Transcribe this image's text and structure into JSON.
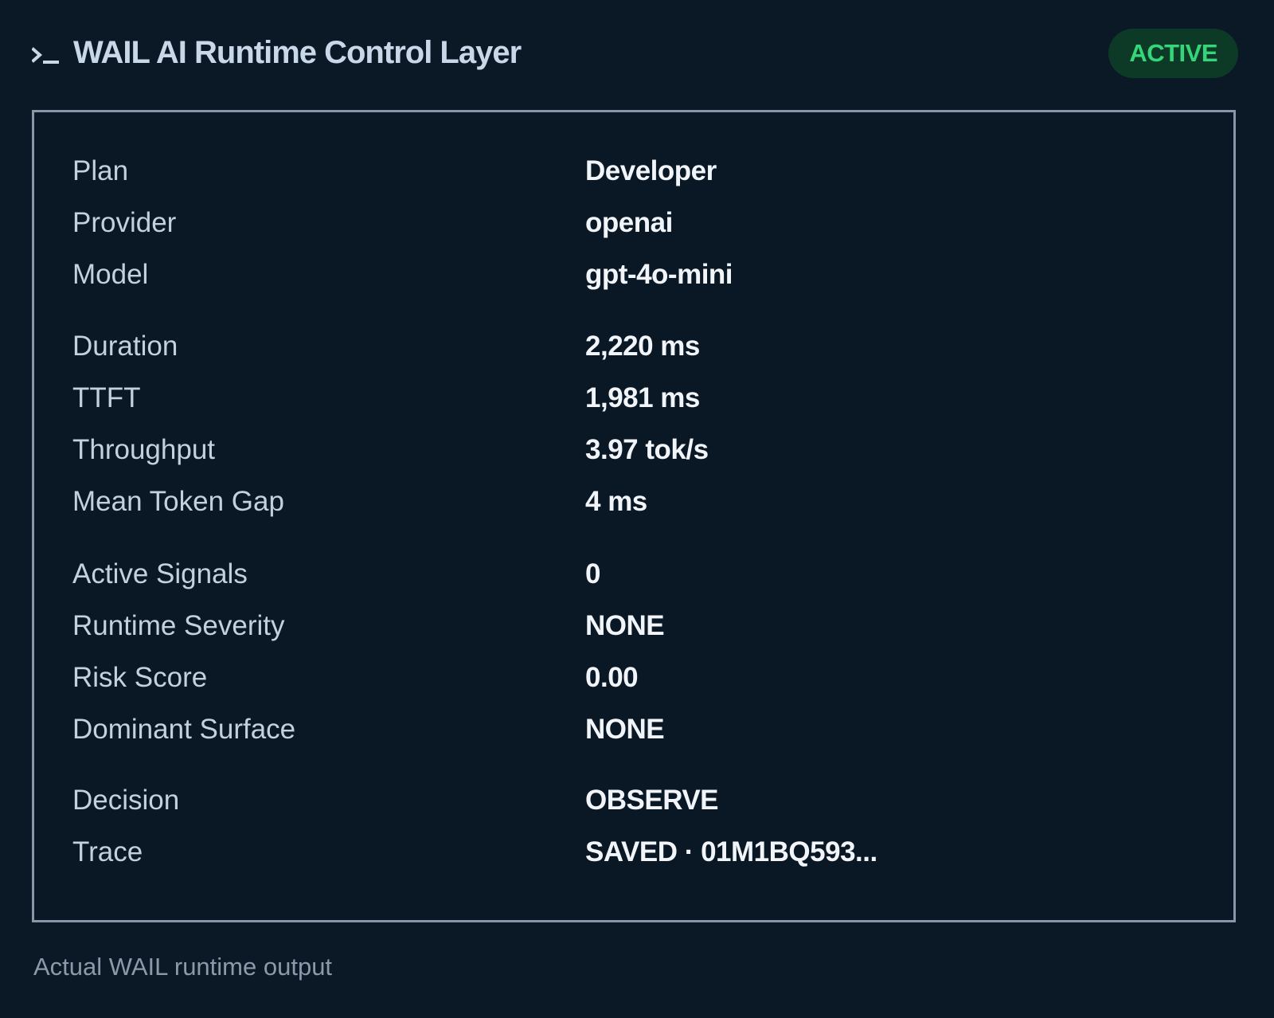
{
  "header": {
    "icon": "terminal-icon",
    "title": "WAIL AI Runtime Control Layer",
    "status": "ACTIVE",
    "status_color": "#35d67a"
  },
  "groups": [
    {
      "rows": [
        {
          "label": "Plan",
          "value": "Developer"
        },
        {
          "label": "Provider",
          "value": "openai"
        },
        {
          "label": "Model",
          "value": "gpt-4o-mini"
        }
      ]
    },
    {
      "rows": [
        {
          "label": "Duration",
          "value": "2,220 ms"
        },
        {
          "label": "TTFT",
          "value": "1,981 ms"
        },
        {
          "label": "Throughput",
          "value": "3.97 tok/s"
        },
        {
          "label": "Mean Token Gap",
          "value": "4 ms"
        }
      ]
    },
    {
      "rows": [
        {
          "label": "Active Signals",
          "value": "0"
        },
        {
          "label": "Runtime Severity",
          "value": "NONE"
        },
        {
          "label": "Risk Score",
          "value": "0.00"
        },
        {
          "label": "Dominant Surface",
          "value": "NONE"
        }
      ]
    },
    {
      "rows": [
        {
          "label": "Decision",
          "value": "OBSERVE"
        },
        {
          "label": "Trace",
          "value": "SAVED · 01M1BQ593..."
        }
      ]
    }
  ],
  "footer": {
    "caption": "Actual WAIL runtime output"
  }
}
